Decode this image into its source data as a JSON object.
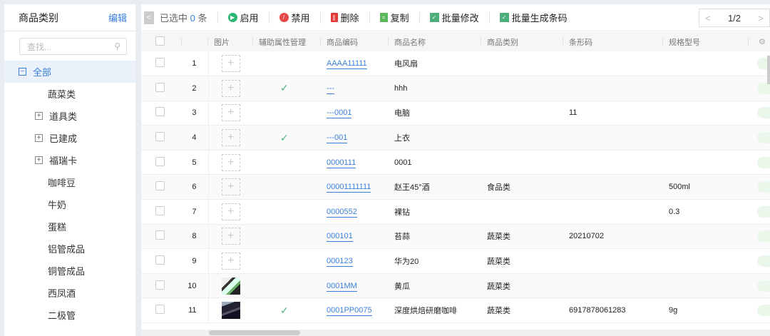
{
  "sidebar": {
    "title": "商品类别",
    "edit": "编辑",
    "search_placeholder": "查找...",
    "items": [
      {
        "label": "全部",
        "box": "−",
        "selected": true
      },
      {
        "label": "蔬菜类"
      },
      {
        "label": "道具类",
        "box": "+"
      },
      {
        "label": "已建成",
        "box": "+"
      },
      {
        "label": "福瑞卡",
        "box": "+"
      },
      {
        "label": "咖啡豆"
      },
      {
        "label": "牛奶"
      },
      {
        "label": "蛋糕"
      },
      {
        "label": "铝管成品"
      },
      {
        "label": "铜管成品"
      },
      {
        "label": "西凤酒"
      },
      {
        "label": "二极管"
      }
    ]
  },
  "toolbar": {
    "selected_prefix": "已选中",
    "selected_count": "0",
    "selected_suffix": "条",
    "enable": "启用",
    "disable": "禁用",
    "delete": "删除",
    "copy": "复制",
    "batch_edit": "批量修改",
    "batch_barcode": "批量生成条码"
  },
  "pager": {
    "page": "1/2"
  },
  "table": {
    "headers": [
      "图片",
      "辅助属性管理",
      "商品编码",
      "商品名称",
      "商品类别",
      "条形码",
      "规格型号"
    ],
    "rows": [
      {
        "idx": "1",
        "img": "none",
        "aux": false,
        "code": "AAAA11111",
        "name": "电风扇",
        "cat": "",
        "barcode": "",
        "spec": ""
      },
      {
        "idx": "2",
        "img": "none",
        "aux": true,
        "code": "---",
        "name": "hhh",
        "cat": "",
        "barcode": "",
        "spec": ""
      },
      {
        "idx": "3",
        "img": "none",
        "aux": false,
        "code": "---0001",
        "name": "电脑",
        "cat": "",
        "barcode": "11",
        "spec": ""
      },
      {
        "idx": "4",
        "img": "none",
        "aux": true,
        "code": "---001",
        "name": "上衣",
        "cat": "",
        "barcode": "",
        "spec": ""
      },
      {
        "idx": "5",
        "img": "none",
        "aux": false,
        "code": "0000111",
        "name": "0001",
        "cat": "",
        "barcode": "",
        "spec": ""
      },
      {
        "idx": "6",
        "img": "none",
        "aux": false,
        "code": "00001111111",
        "name": "赵王45°酒",
        "cat": "食品类",
        "barcode": "",
        "spec": "500ml"
      },
      {
        "idx": "7",
        "img": "none",
        "aux": false,
        "code": "0000552",
        "name": "裸钻",
        "cat": "",
        "barcode": "",
        "spec": "0.3"
      },
      {
        "idx": "8",
        "img": "none",
        "aux": false,
        "code": "000101",
        "name": "苔蒜",
        "cat": "蔬菜类",
        "barcode": "20210702",
        "spec": ""
      },
      {
        "idx": "9",
        "img": "none",
        "aux": false,
        "code": "000123",
        "name": "华为20",
        "cat": "蔬菜类",
        "barcode": "",
        "spec": ""
      },
      {
        "idx": "10",
        "img": "photo",
        "aux": false,
        "code": "0001MM",
        "name": "黄瓜",
        "cat": "蔬菜类",
        "barcode": "",
        "spec": ""
      },
      {
        "idx": "11",
        "img": "photo-dark",
        "aux": true,
        "code": "0001PP0075",
        "name": "深度烘焙研磨咖啡",
        "cat": "蔬菜类",
        "barcode": "6917878061283",
        "spec": "9g"
      }
    ]
  },
  "colors": {
    "accent": "#3a7fdc",
    "enable": "#2bb673",
    "disable": "#e64848",
    "delete": "#e03a3a",
    "green": "#4caf7a"
  }
}
